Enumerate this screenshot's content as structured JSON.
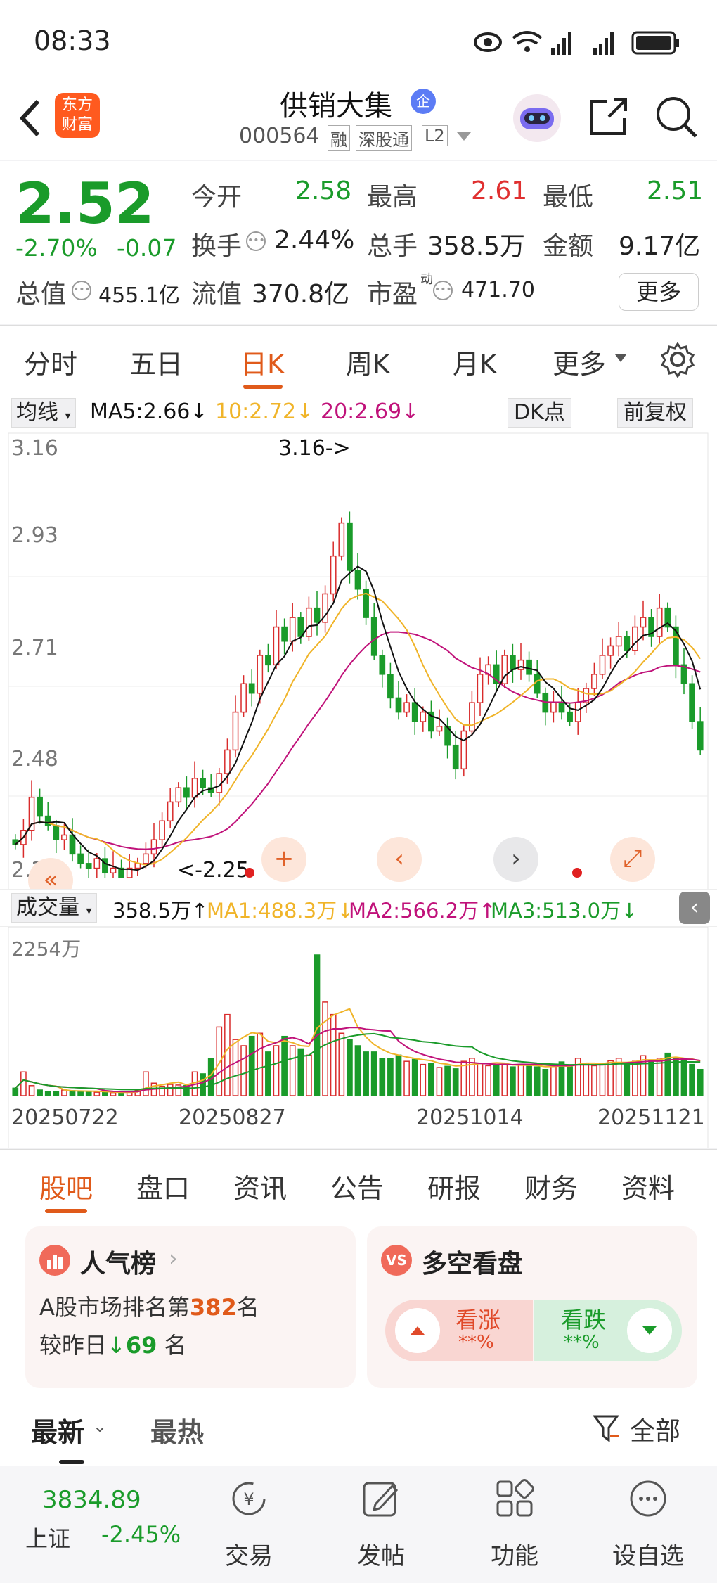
{
  "status_bar": {
    "time": "08:33"
  },
  "header": {
    "logo_text": "东方\n财富",
    "stock_name": "供销大集",
    "badge": "企",
    "stock_code": "000564",
    "tags": [
      "融",
      "深股通",
      "L2"
    ]
  },
  "quote": {
    "price": "2.52",
    "change_pct": "-2.70%",
    "change_amt": "-0.07",
    "fields": {
      "open_label": "今开",
      "open": "2.58",
      "high_label": "最高",
      "high": "2.61",
      "low_label": "最低",
      "low": "2.51",
      "turnover_label": "换手",
      "turnover": "2.44%",
      "volume_label": "总手",
      "volume": "358.5万",
      "amount_label": "金额",
      "amount": "9.17亿",
      "mktcap_label": "总值",
      "mktcap": "455.1亿",
      "float_label": "流值",
      "float": "370.8亿",
      "pe_label": "市盈",
      "pe_sup": "动",
      "pe": "471.70"
    },
    "more_button": "更多"
  },
  "period_tabs": [
    "分时",
    "五日",
    "日K",
    "周K",
    "月K",
    "更多"
  ],
  "active_period": "日K",
  "chart": {
    "ma_selector": "均线",
    "ma5": "MA5:2.66↓",
    "ma10": "10:2.72↓",
    "ma20": "20:2.69↓",
    "dk_button": "DK点",
    "adjust_button": "前复权",
    "price_ticks": [
      "3.16",
      "2.93",
      "2.71",
      "2.48",
      "2.25"
    ],
    "high_marker": "3.16->",
    "low_marker": "<-2.25",
    "volume_selector": "成交量",
    "volume_current": "358.5万↑",
    "vol_ma1": "MA1:488.3万↓",
    "vol_ma2": "MA2:566.2万↑",
    "vol_ma3": "MA3:513.0万↓",
    "volume_max": "2254万",
    "dates": [
      "20250722",
      "20250827",
      "20251014",
      "20251121"
    ],
    "colors": {
      "up": "#d92b2b",
      "down": "#1a9b2a",
      "ma5": "#111111",
      "ma10": "#f0b429",
      "ma20": "#c0127a"
    }
  },
  "chart_data": {
    "type": "candlestick",
    "price_ticks": [
      3.16,
      2.93,
      2.71,
      2.48,
      2.25
    ],
    "period_high": 3.16,
    "period_low": 2.25,
    "last_close": 2.52,
    "date_labels": [
      "20250722",
      "20250827",
      "20251014",
      "20251121"
    ],
    "moving_averages": {
      "MA5": 2.66,
      "MA10": 2.72,
      "MA20": 2.69
    },
    "volume_ma": {
      "MA1": "488.3万",
      "MA2": "566.2万",
      "MA3": "513.0万"
    },
    "volume_axis_max": "2254万",
    "closes": [
      2.32,
      2.35,
      2.42,
      2.38,
      2.36,
      2.33,
      2.34,
      2.3,
      2.28,
      2.27,
      2.29,
      2.26,
      2.27,
      2.25,
      2.27,
      2.28,
      2.3,
      2.33,
      2.37,
      2.41,
      2.44,
      2.42,
      2.46,
      2.44,
      2.43,
      2.47,
      2.52,
      2.6,
      2.66,
      2.64,
      2.72,
      2.7,
      2.78,
      2.75,
      2.8,
      2.76,
      2.82,
      2.79,
      2.85,
      2.93,
      3.0,
      2.9,
      2.86,
      2.8,
      2.72,
      2.68,
      2.63,
      2.6,
      2.62,
      2.58,
      2.6,
      2.56,
      2.57,
      2.53,
      2.48,
      2.56,
      2.62,
      2.68,
      2.7,
      2.66,
      2.72,
      2.69,
      2.71,
      2.68,
      2.64,
      2.6,
      2.62,
      2.6,
      2.58,
      2.62,
      2.65,
      2.68,
      2.72,
      2.74,
      2.76,
      2.73,
      2.78,
      2.8,
      2.76,
      2.82,
      2.78,
      2.7,
      2.66,
      2.58,
      2.52
    ],
    "volumes": [
      120,
      380,
      160,
      90,
      70,
      60,
      90,
      80,
      70,
      60,
      55,
      60,
      50,
      45,
      60,
      80,
      380,
      200,
      150,
      180,
      170,
      160,
      380,
      350,
      600,
      1100,
      1300,
      900,
      800,
      950,
      1000,
      700,
      800,
      950,
      800,
      750,
      650,
      2254,
      1500,
      1300,
      1000,
      900,
      800,
      700,
      700,
      600,
      600,
      650,
      550,
      580,
      500,
      520,
      450,
      470,
      430,
      550,
      600,
      520,
      480,
      480,
      520,
      460,
      500,
      480,
      460,
      420,
      480,
      540,
      460,
      600,
      520,
      480,
      500,
      560,
      600,
      520,
      550,
      640,
      560,
      600,
      680,
      600,
      560,
      500,
      420
    ]
  },
  "content_tabs": [
    "股吧",
    "盘口",
    "资讯",
    "公告",
    "研报",
    "财务",
    "资料"
  ],
  "active_content_tab": "股吧",
  "popularity_card": {
    "title": "人气榜",
    "line1_prefix": "A股市场排名第",
    "rank": "382",
    "line1_suffix": "名",
    "line2_prefix": "较昨日",
    "change": "69",
    "line2_suffix": "名"
  },
  "sentiment_card": {
    "title": "多空看盘",
    "bull_label": "看涨",
    "bull_value": "**%",
    "bear_label": "看跌",
    "bear_value": "**%"
  },
  "feed_tabs": {
    "latest": "最新",
    "hot": "最热",
    "filter": "全部"
  },
  "bottom_nav": {
    "index_value": "3834.89",
    "index_name": "上证",
    "index_change": "-2.45%",
    "items": [
      "交易",
      "发帖",
      "功能",
      "设自选"
    ]
  }
}
